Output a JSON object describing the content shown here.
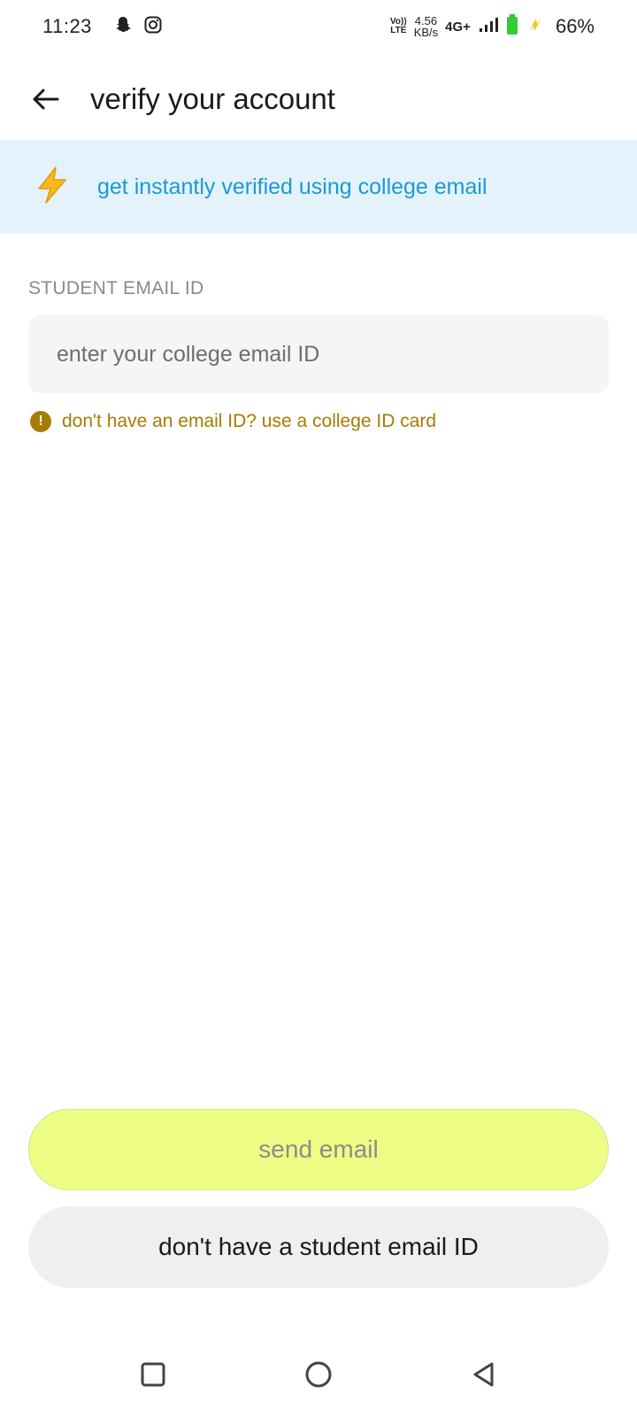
{
  "status_bar": {
    "time": "11:23",
    "volte_top": "Vo))",
    "volte_bottom": "LTE",
    "speed_value": "4.56",
    "speed_unit": "KB/s",
    "network": "4G+",
    "battery_percent": "66%",
    "icons": [
      "snapchat-icon",
      "instagram-icon",
      "signal-icon",
      "battery-icon",
      "charging-icon"
    ]
  },
  "header": {
    "title": "verify your account",
    "back_icon": "back-arrow-icon"
  },
  "banner": {
    "icon": "lightning-icon",
    "text": "get instantly verified using college email"
  },
  "form": {
    "label": "STUDENT EMAIL ID",
    "placeholder": "enter your college email ID",
    "value": "",
    "hint_icon": "exclamation-icon",
    "hint_text": "don't have an email ID? use a college ID card"
  },
  "actions": {
    "primary_label": "send email",
    "secondary_label": "don't have a student email ID"
  },
  "nav": {
    "items": [
      "recents-icon",
      "home-icon",
      "back-icon"
    ]
  },
  "colors": {
    "banner_bg": "#e4f2fb",
    "banner_text": "#1a9ad6",
    "hint": "#a57c00",
    "primary_button": "#eefe85",
    "secondary_button": "#efefef"
  }
}
